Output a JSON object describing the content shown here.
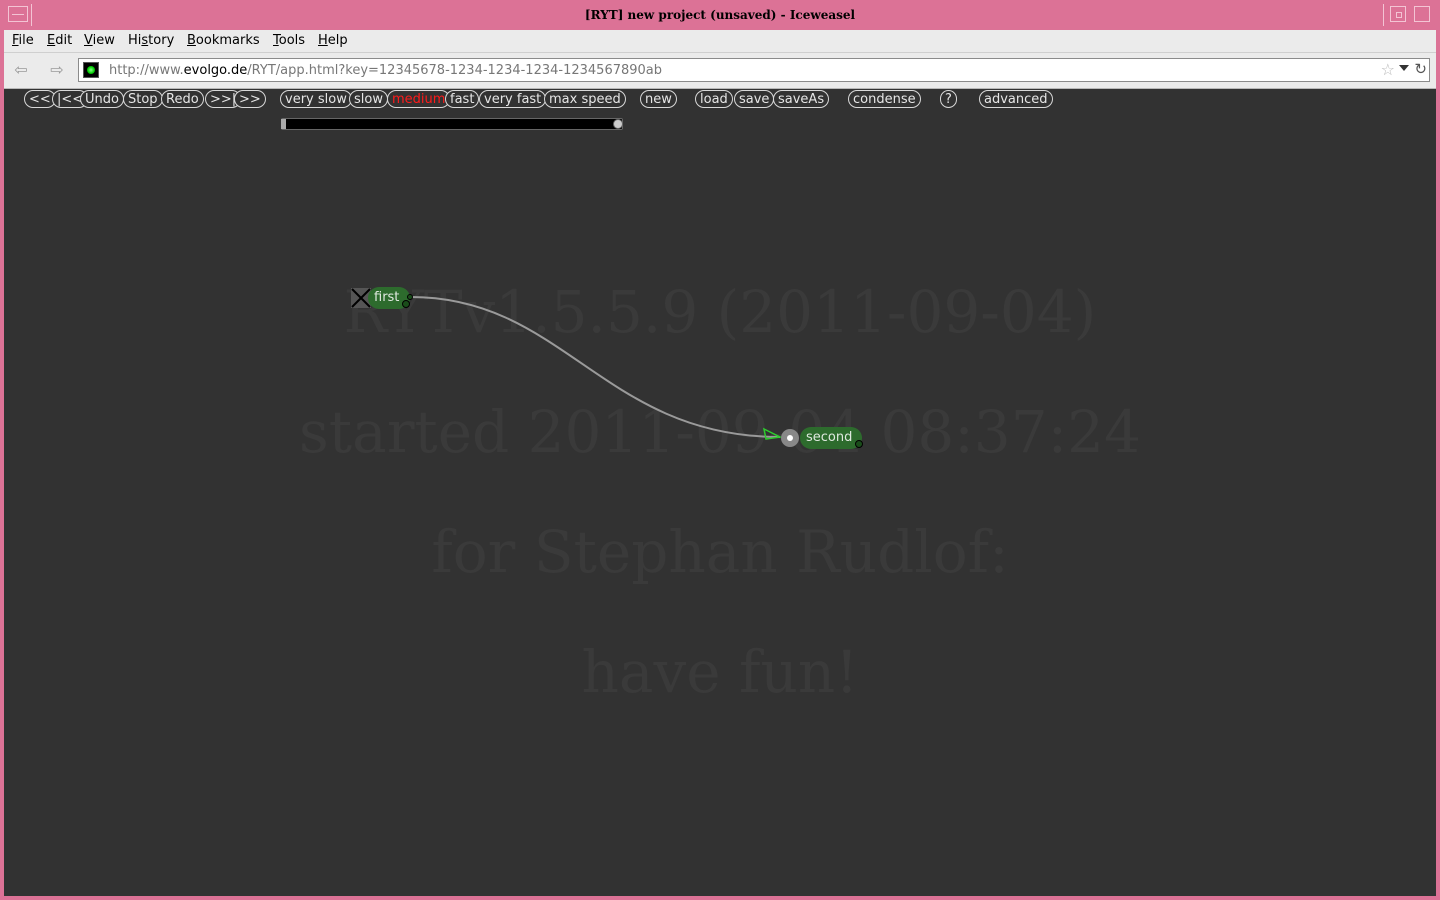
{
  "window": {
    "title": "[RYT] new project (unsaved) - Iceweasel"
  },
  "menubar": {
    "items": [
      {
        "label": "File",
        "accel": "F"
      },
      {
        "label": "Edit",
        "accel": "E"
      },
      {
        "label": "View",
        "accel": "V"
      },
      {
        "label": "History",
        "accel": "s"
      },
      {
        "label": "Bookmarks",
        "accel": "B"
      },
      {
        "label": "Tools",
        "accel": "T"
      },
      {
        "label": "Help",
        "accel": "H"
      }
    ]
  },
  "navbar": {
    "url_prefix": "http://www.",
    "url_domain": "evolgo.de",
    "url_path": "/RYT/app.html?key=12345678-1234-1234-1234-1234567890ab",
    "back_icon": "back-arrow-icon",
    "forward_icon": "forward-arrow-icon",
    "bookmark_icon": "star-icon",
    "reload_icon": "reload-icon"
  },
  "toolbar": {
    "history_buttons": [
      "<<",
      "|<<",
      "Undo",
      "Stop",
      "Redo",
      ">>|",
      ">>"
    ],
    "speed_buttons": [
      "very slow",
      "slow",
      "medium",
      "fast",
      "very fast",
      "max speed"
    ],
    "active_speed": "medium",
    "active_color": "#ff1a1a",
    "new_label": "new",
    "file_buttons": [
      "load",
      "save",
      "saveAs"
    ],
    "condense_label": "condense",
    "help_label": "?",
    "advanced_label": "advanced"
  },
  "speed_slider": {
    "value": 1.0
  },
  "splash": {
    "lines": [
      "RYTv1.5.5.9 (2011-09-04)",
      "started 2011-09-04 08:37:24",
      "for Stephan Rudlof:",
      "have fun!"
    ]
  },
  "graph": {
    "nodes": [
      {
        "id": "first",
        "label": "first"
      },
      {
        "id": "second",
        "label": "second"
      }
    ],
    "edges": [
      {
        "from": "first",
        "to": "second"
      }
    ],
    "node_color": "#2d6b2d",
    "edge_color": "#9a9a9a",
    "arrow_color": "#2ecc2e"
  }
}
